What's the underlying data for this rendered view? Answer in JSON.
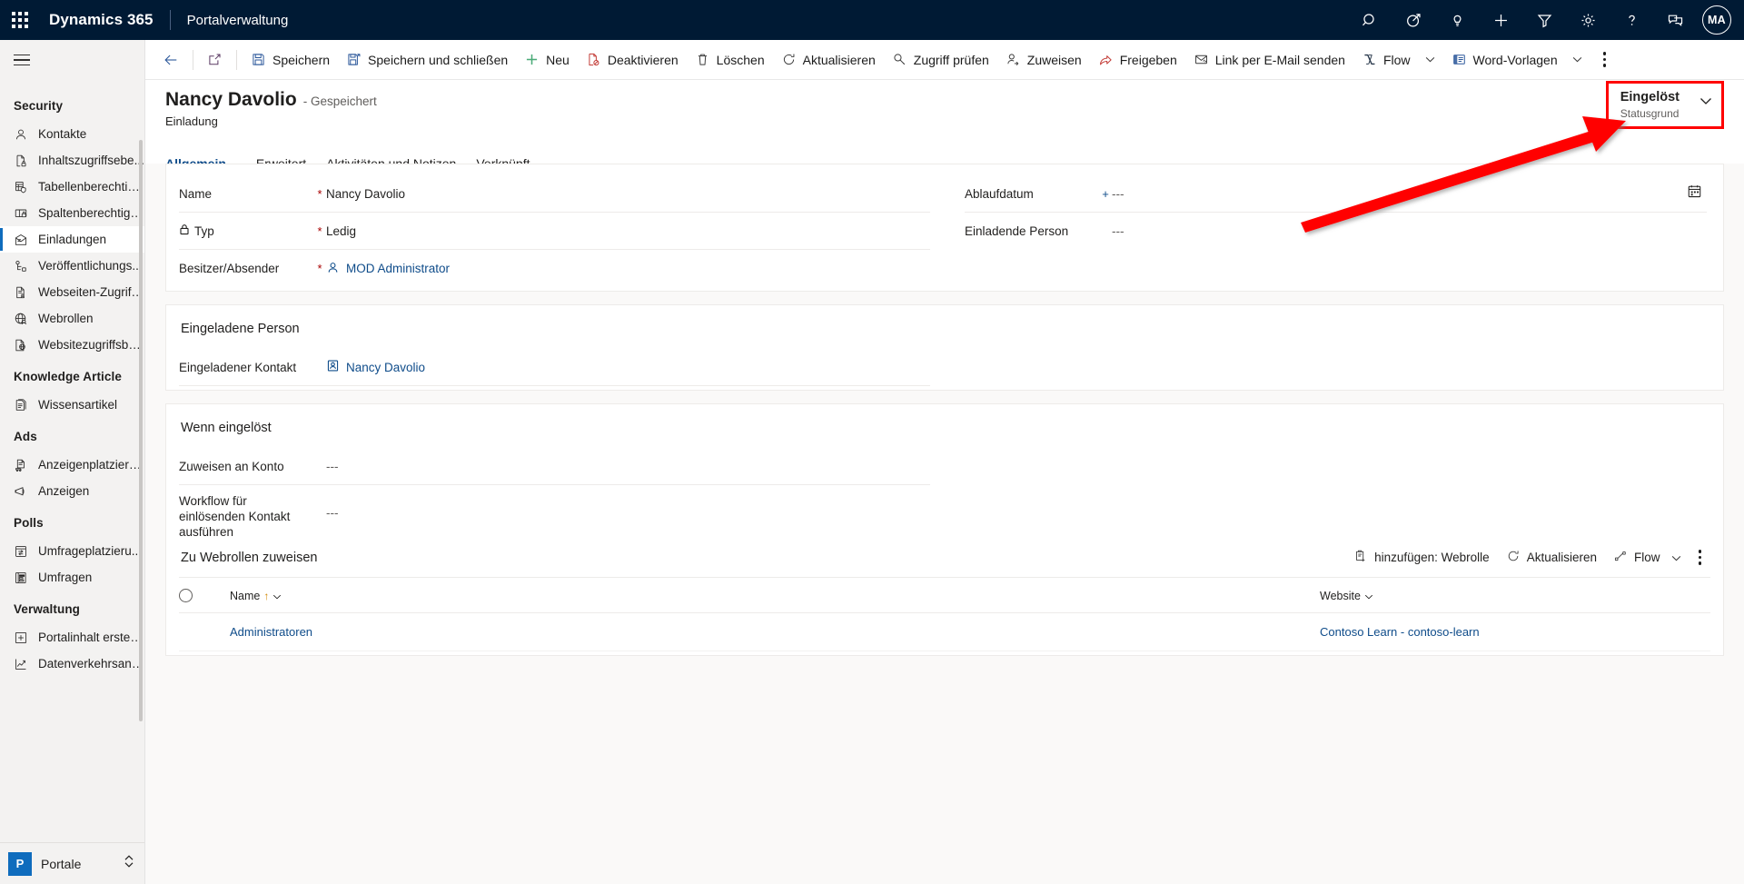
{
  "topnav": {
    "waffle_label": "app-launcher",
    "brand": "Dynamics 365",
    "app_name": "Portalverwaltung",
    "icons": [
      {
        "name": "search-icon",
        "label": "Suche"
      },
      {
        "name": "diagnostics-icon",
        "label": "Diagnose"
      },
      {
        "name": "lightbulb-icon",
        "label": "Ideen"
      },
      {
        "name": "add-icon",
        "label": "Neu"
      },
      {
        "name": "filter-icon",
        "label": "Filter"
      },
      {
        "name": "gear-icon",
        "label": "Einstellungen"
      },
      {
        "name": "help-icon",
        "label": "Hilfe"
      },
      {
        "name": "feedback-icon",
        "label": "Feedback"
      }
    ],
    "avatar_initials": "MA"
  },
  "commandbar": {
    "back_label": "Zurück",
    "popout_label": "In neuem Fenster öffnen",
    "items": [
      {
        "name": "save-button",
        "label": "Speichern",
        "icon": "save-icon",
        "chevron": false
      },
      {
        "name": "save-and-close-button",
        "label": "Speichern und schließen",
        "icon": "save-close-icon",
        "chevron": false
      },
      {
        "name": "new-button",
        "label": "Neu",
        "icon": "plus-icon",
        "chevron": false
      },
      {
        "name": "deactivate-button",
        "label": "Deaktivieren",
        "icon": "deactivate-icon",
        "chevron": false
      },
      {
        "name": "delete-button",
        "label": "Löschen",
        "icon": "trash-icon",
        "chevron": false
      },
      {
        "name": "refresh-button",
        "label": "Aktualisieren",
        "icon": "refresh-icon",
        "chevron": false
      },
      {
        "name": "check-access-button",
        "label": "Zugriff prüfen",
        "icon": "key-icon",
        "chevron": false
      },
      {
        "name": "assign-button",
        "label": "Zuweisen",
        "icon": "assign-user-icon",
        "chevron": false
      },
      {
        "name": "share-button",
        "label": "Freigeben",
        "icon": "share-icon",
        "chevron": false
      },
      {
        "name": "email-link-button",
        "label": "Link per E-Mail senden",
        "icon": "email-link-icon",
        "chevron": false
      },
      {
        "name": "flow-button",
        "label": "Flow",
        "icon": "flow-icon",
        "chevron": true
      },
      {
        "name": "word-templates-button",
        "label": "Word-Vorlagen",
        "icon": "word-icon",
        "chevron": true
      }
    ],
    "overflow_label": "Weitere Befehle"
  },
  "sidebar": {
    "hamburger_label": "Websitemap",
    "groups": [
      {
        "name": "Security",
        "label": "Security",
        "items": [
          {
            "name": "sidebar-item-kontakte",
            "label": "Kontakte",
            "icon": "contact-icon",
            "active": false
          },
          {
            "name": "sidebar-item-inhaltszugriffsebenen",
            "label": "Inhaltszugriffsebe...",
            "icon": "content-access-icon",
            "active": false
          },
          {
            "name": "sidebar-item-tabellenberechtigungen",
            "label": "Tabellenberechtig...",
            "icon": "table-permission-icon",
            "active": false
          },
          {
            "name": "sidebar-item-spaltenberechtigungen",
            "label": "Spaltenberechtigu...",
            "icon": "column-permission-icon",
            "active": false
          },
          {
            "name": "sidebar-item-einladungen",
            "label": "Einladungen",
            "icon": "invitation-icon",
            "active": true
          },
          {
            "name": "sidebar-item-veroeffentlichungs",
            "label": "Veröffentlichungs...",
            "icon": "publishing-icon",
            "active": false
          },
          {
            "name": "sidebar-item-webseiten-zugriff",
            "label": "Webseiten-Zugriff...",
            "icon": "webpage-access-icon",
            "active": false
          },
          {
            "name": "sidebar-item-webrollen",
            "label": "Webrollen",
            "icon": "webrole-icon",
            "active": false
          },
          {
            "name": "sidebar-item-websitezugriff",
            "label": "Websitezugriffsbe...",
            "icon": "website-access-icon",
            "active": false
          }
        ]
      },
      {
        "name": "Knowledge Article",
        "label": "Knowledge Article",
        "items": [
          {
            "name": "sidebar-item-wissensartikel",
            "label": "Wissensartikel",
            "icon": "knowledge-article-icon",
            "active": false
          }
        ]
      },
      {
        "name": "Ads",
        "label": "Ads",
        "items": [
          {
            "name": "sidebar-item-anzeigenplatzierung",
            "label": "Anzeigenplatzieru...",
            "icon": "ad-placement-icon",
            "active": false
          },
          {
            "name": "sidebar-item-anzeigen",
            "label": "Anzeigen",
            "icon": "ad-icon",
            "active": false
          }
        ]
      },
      {
        "name": "Polls",
        "label": "Polls",
        "items": [
          {
            "name": "sidebar-item-umfrageplatzierung",
            "label": "Umfrageplatzieru...",
            "icon": "poll-placement-icon",
            "active": false
          },
          {
            "name": "sidebar-item-umfragen",
            "label": "Umfragen",
            "icon": "poll-icon",
            "active": false
          }
        ]
      },
      {
        "name": "Verwaltung",
        "label": "Verwaltung",
        "items": [
          {
            "name": "sidebar-item-portalinhalt",
            "label": "Portalinhalt erstell...",
            "icon": "create-portal-content-icon",
            "active": false
          },
          {
            "name": "sidebar-item-datenverkehrsanalyse",
            "label": "Datenverkehrsana...",
            "icon": "analytics-icon",
            "active": false
          }
        ]
      }
    ],
    "area_switcher": {
      "badge": "P",
      "label": "Portale"
    }
  },
  "record": {
    "title": "Nancy Davolio",
    "saved_state": "- Gespeichert",
    "entity": "Einladung",
    "status": {
      "value": "Eingelöst",
      "label": "Statusgrund"
    },
    "tabs": [
      {
        "name": "tab-allgemein",
        "label": "Allgemein",
        "active": true
      },
      {
        "name": "tab-erweitert",
        "label": "Erweitert",
        "active": false
      },
      {
        "name": "tab-aktivitaeten",
        "label": "Aktivitäten und Notizen",
        "active": false
      },
      {
        "name": "tab-verknuepft",
        "label": "Verknüpft",
        "active": false
      }
    ]
  },
  "form": {
    "general": {
      "left": [
        {
          "name": "field-name",
          "label": "Name",
          "marker": "required",
          "value": "Nancy Davolio",
          "kind": "text",
          "lock": false
        },
        {
          "name": "field-typ",
          "label": "Typ",
          "marker": "required",
          "value": "Ledig",
          "kind": "text",
          "lock": true
        },
        {
          "name": "field-besitzer-absender",
          "label": "Besitzer/Absender",
          "marker": "required",
          "value": "MOD Administrator",
          "kind": "lookup-user",
          "lock": false
        }
      ],
      "right": [
        {
          "name": "field-ablaufdatum",
          "label": "Ablaufdatum",
          "marker": "recommended",
          "value": "---",
          "kind": "date",
          "lock": false
        },
        {
          "name": "field-einladende-person",
          "label": "Einladende Person",
          "marker": "none",
          "value": "---",
          "kind": "text",
          "lock": false
        }
      ]
    },
    "invited_person": {
      "title": "Eingeladene Person",
      "fields": [
        {
          "name": "field-eingeladener-kontakt",
          "label": "Eingeladener Kontakt",
          "marker": "none",
          "value": "Nancy Davolio",
          "kind": "lookup-contact",
          "lock": false
        }
      ]
    },
    "when_redeemed": {
      "title": "Wenn eingelöst",
      "fields": [
        {
          "name": "field-zuweisen-an-konto",
          "label": "Zuweisen an Konto",
          "marker": "none",
          "value": "---",
          "kind": "text",
          "lock": false
        },
        {
          "name": "field-workflow-einloesender-kontakt",
          "label": "Workflow für einlösenden Kontakt ausführen",
          "marker": "none",
          "value": "---",
          "kind": "text",
          "lock": false
        }
      ]
    },
    "subgrid": {
      "title": "Zu Webrollen zuweisen",
      "commands": [
        {
          "name": "add-webrole-button",
          "label": "hinzufügen: Webrolle",
          "icon": "add-record-icon",
          "chevron": false
        },
        {
          "name": "subgrid-refresh-button",
          "label": "Aktualisieren",
          "icon": "refresh-icon",
          "chevron": false
        },
        {
          "name": "subgrid-flow-button",
          "label": "Flow",
          "icon": "flow-small-icon",
          "chevron": true
        }
      ],
      "overflow_label": "Weitere Befehle",
      "columns": [
        {
          "name": "column-name",
          "label": "Name",
          "sort": "asc"
        },
        {
          "name": "column-website",
          "label": "Website",
          "sort": "none"
        }
      ],
      "rows": [
        {
          "name": "Administratoren",
          "website": "Contoso Learn - contoso-learn"
        }
      ]
    }
  },
  "colors": {
    "navbar": "#001A34",
    "accent": "#0f6cbd",
    "link": "#0f4c8a",
    "required": "#a80000",
    "annotation": "#ff0000",
    "sidebar_bg": "#f3f2f1",
    "form_bg": "#faf9f8",
    "sort": "#d08700"
  }
}
